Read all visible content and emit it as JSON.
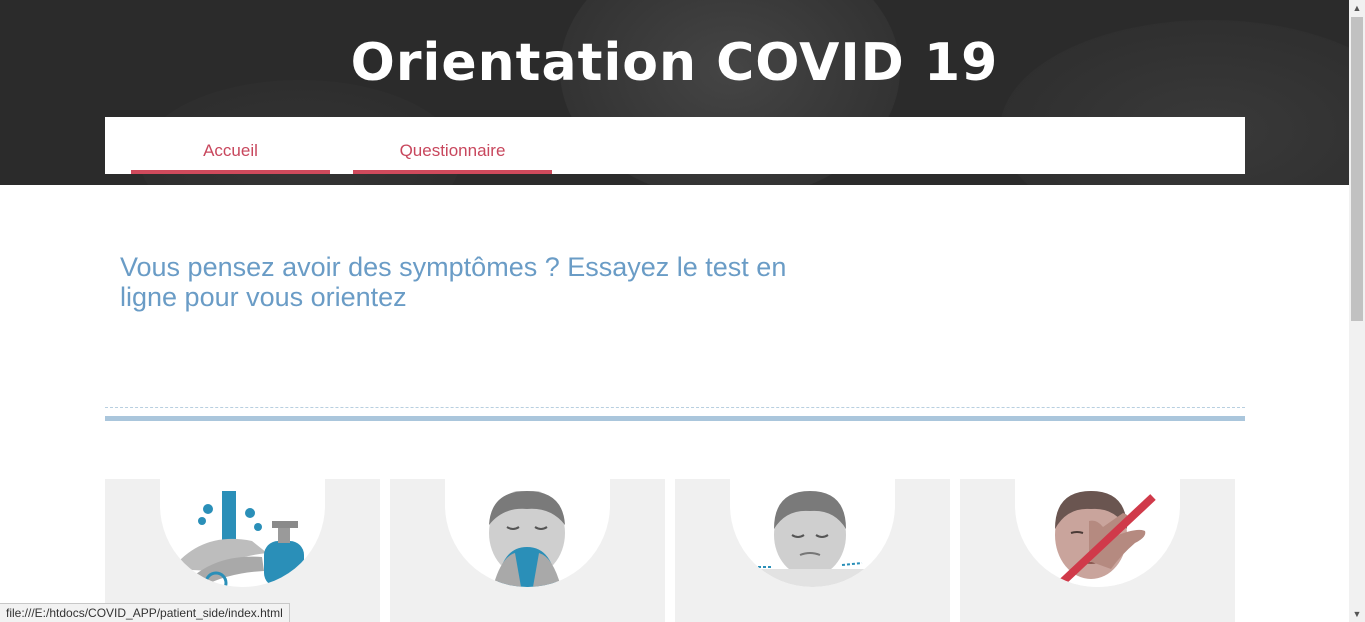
{
  "header": {
    "title": "Orientation COVID 19"
  },
  "nav": {
    "items": [
      {
        "label": "Accueil"
      },
      {
        "label": "Questionnaire"
      }
    ]
  },
  "main": {
    "lead_text": "Vous pensez avoir des symptômes ? Essayez le test en ligne pour vous orientez"
  },
  "cards": [
    {
      "icon": "hand-washing-icon"
    },
    {
      "icon": "sneeze-into-elbow-icon"
    },
    {
      "icon": "sick-person-resting-icon"
    },
    {
      "icon": "no-face-touching-icon"
    }
  ],
  "status_bar": {
    "url": "file:///E:/htdocs/COVID_APP/patient_side/index.html"
  },
  "colors": {
    "accent_red": "#cf4a5c",
    "accent_blue": "#6a9cc6",
    "header_bg": "#2b2b2b"
  }
}
